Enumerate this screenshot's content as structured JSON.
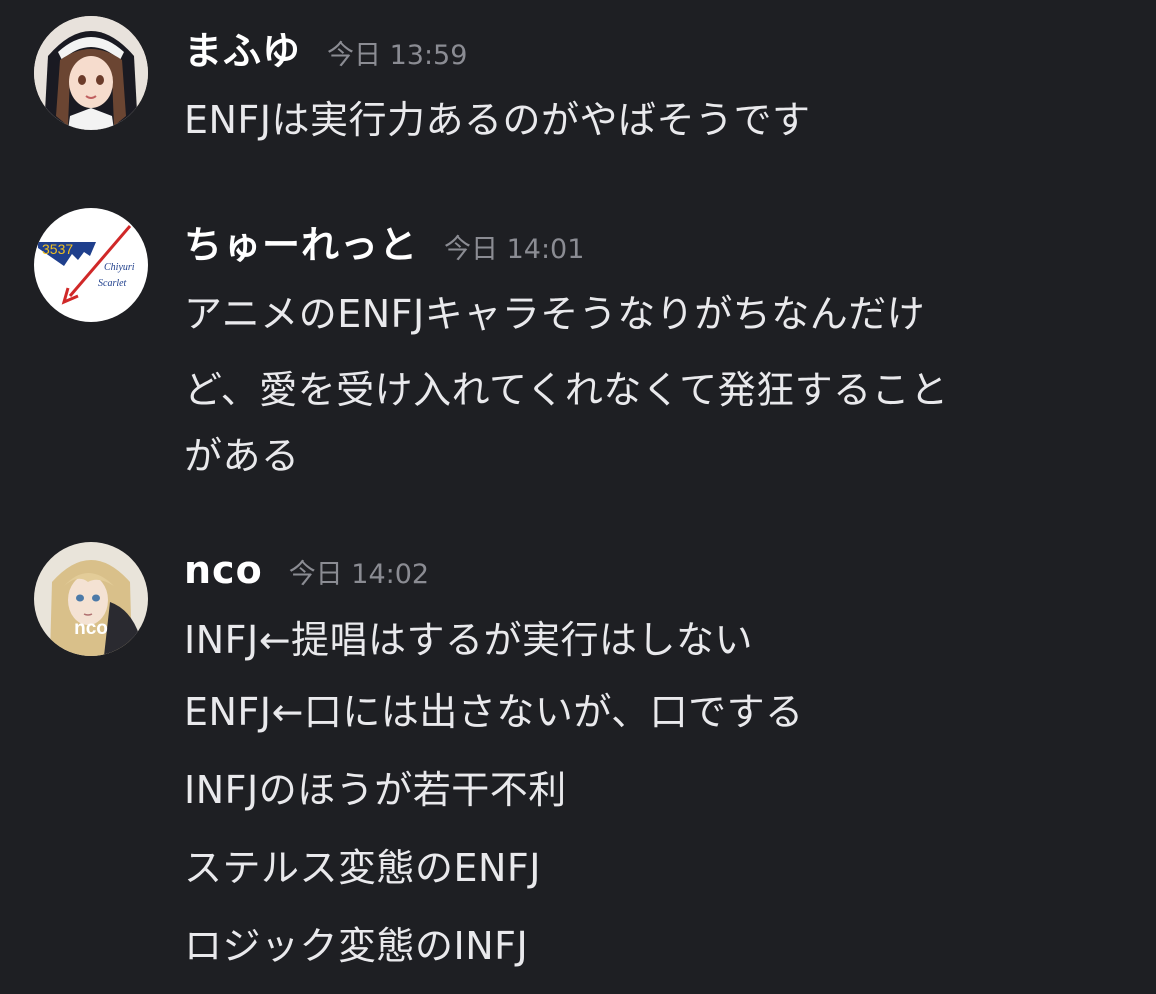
{
  "messages": [
    {
      "username": "まふゆ",
      "timestamp": "今日 13:59",
      "avatar_icon": "nun-girl-avatar",
      "lines": [
        "ENFJは実行力あるのがやばそうです"
      ]
    },
    {
      "username": "ちゅーれっと",
      "timestamp": "今日 14:01",
      "avatar_icon": "chiyuri-scarlet-logo-avatar",
      "avatar_text": "3537",
      "avatar_subtext_1": "Chiyuri",
      "avatar_subtext_2": "Scarlet",
      "lines": [
        "アニメのENFJキャラそうなりがちなんだけ",
        "ど、愛を受け入れてくれなくて発狂すること",
        "がある"
      ]
    },
    {
      "username": "nco",
      "timestamp": "今日 14:02",
      "avatar_icon": "blonde-girl-avatar",
      "avatar_text": "nco",
      "lines": [
        "INFJ←提唱はするが実行はしない",
        "ENFJ←口には出さないが、口でする",
        "INFJのほうが若干不利",
        "ステルス変態のENFJ",
        "ロジック変態のINFJ"
      ]
    }
  ],
  "colors": {
    "background": "#1e1f23",
    "username": "#ffffff",
    "timestamp": "#8b8c93",
    "message_text": "#e9e9ec"
  }
}
